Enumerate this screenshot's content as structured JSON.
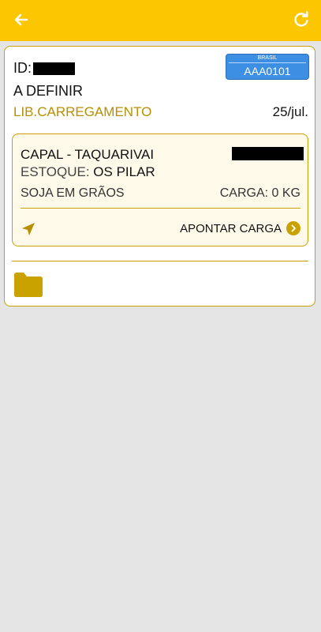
{
  "colors": {
    "header": "#fcc600",
    "accent": "#c9a200",
    "status_text": "#b88f00",
    "plate_blue": "#3d8fe3",
    "background": "#e5e5e5"
  },
  "header": {
    "back_icon": "arrow-left-icon",
    "refresh_icon": "refresh-icon"
  },
  "card": {
    "id_label": "ID:",
    "plate": {
      "country": "BRASIL",
      "number": "AAA0101"
    },
    "destination": "A DEFINIR",
    "status": "LIB.CARREGAMENTO",
    "date": "25/jul.",
    "load": {
      "origin": "CAPAL - TAQUARIVAI",
      "stock_label": "ESTOQUE:",
      "stock_value": "OS PILAR",
      "product": "SOJA EM GRÃOS",
      "cargo": "CARGA: 0 KG",
      "nav_icon": "navigation-arrow-icon",
      "action_label": "APONTAR CARGA",
      "action_icon": "chevron-right-circle-icon"
    },
    "folder_icon": "folder-icon"
  }
}
